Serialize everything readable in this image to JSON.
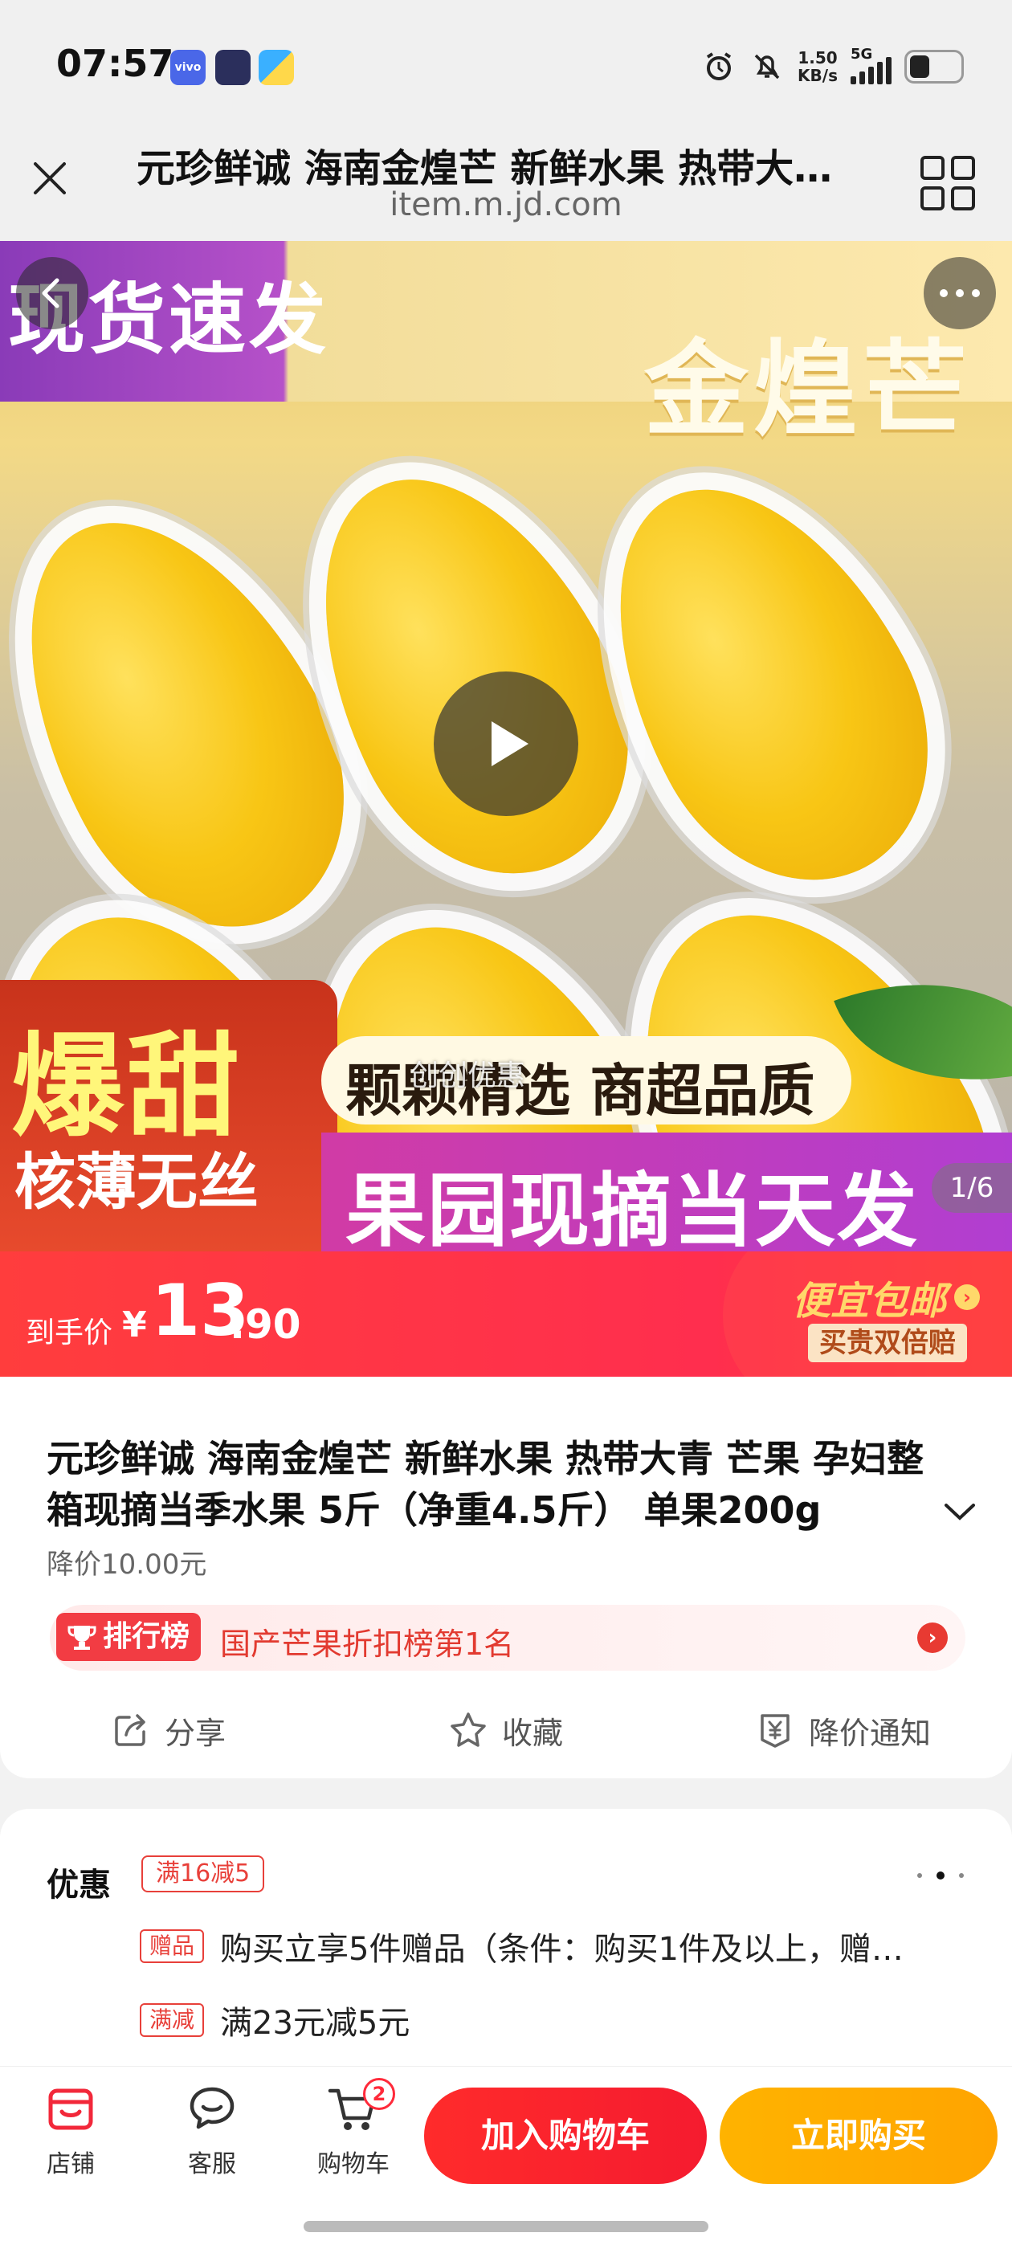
{
  "status_bar": {
    "time": "07:57",
    "apps": [
      "vivo",
      "",
      ""
    ],
    "speed_value": "1.50",
    "speed_unit": "KB/s",
    "network": "5G",
    "icons": [
      "alarm-icon",
      "mute-icon",
      "signal-icon",
      "battery-icon"
    ]
  },
  "header": {
    "title": "元珍鲜诚 海南金煌芒 新鲜水果 热带大青 芒果 孕妇整箱现摘当季水果 5斤（净重4.5斤） 单果200g",
    "url": "item.m.jd.com"
  },
  "hero": {
    "tag_left": "现货速发",
    "tag_right": "金煌芒",
    "bottom_left_big": "爆甜",
    "bottom_left_small": "核薄无丝",
    "bottom_pill": "颗颗精选 商超品质",
    "bottom_stripe": "果园现摘当天发",
    "watermark": "创创优惠",
    "counter": "1/6"
  },
  "price": {
    "label": "到手价",
    "currency": "¥",
    "integer": "13",
    "decimal": ".90",
    "cheap_shipping": "便宜包邮",
    "double_comp": "买贵双倍赔"
  },
  "product": {
    "title": "元珍鲜诚 海南金煌芒 新鲜水果 热带大青 芒果 孕妇整箱现摘当季水果 5斤（净重4.5斤） 单果200g",
    "price_drop": "降价10.00元",
    "rank_tag": "排行榜",
    "rank_text": "国产芒果折扣榜第1名",
    "actions": {
      "share": "分享",
      "favorite": "收藏",
      "price_alert": "降价通知"
    }
  },
  "promo": {
    "label": "优惠",
    "coupon": "满16减5",
    "rows": [
      {
        "tag": "赠品",
        "text": "购买立享5件赠品（条件：购买1件及以上，赠…"
      },
      {
        "tag": "满减",
        "text": "满23元减5元"
      }
    ]
  },
  "bottom_bar": {
    "store": "店铺",
    "service": "客服",
    "cart": "购物车",
    "cart_count": "2",
    "add_to_cart": "加入购物车",
    "buy_now": "立即购买"
  },
  "colors": {
    "accent_red": "#ff2e3e",
    "accent_orange": "#ffab00"
  }
}
